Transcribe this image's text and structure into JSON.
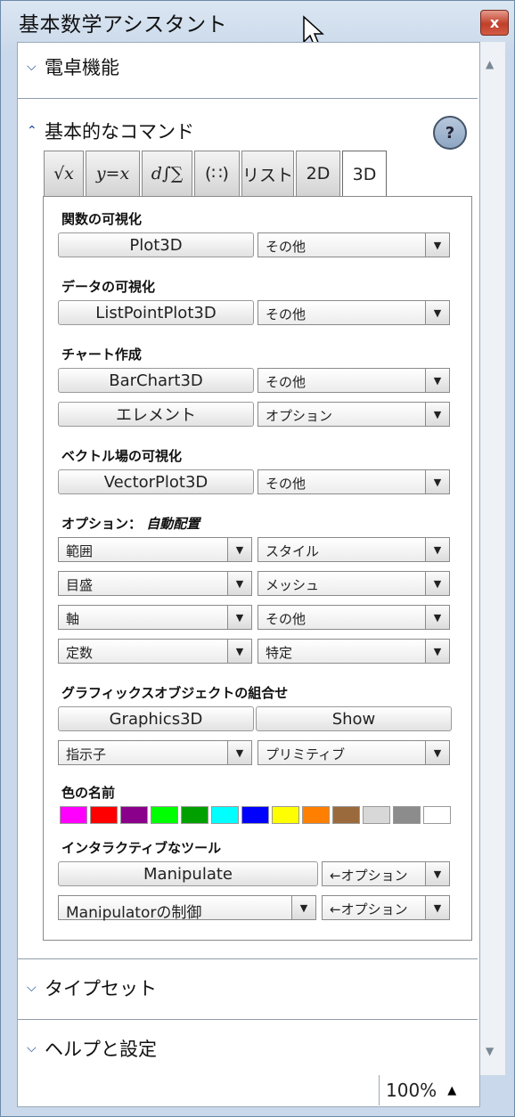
{
  "window": {
    "title": "基本数学アシスタント",
    "close_label": "x"
  },
  "sections": {
    "calculator": "電卓機能",
    "basic_commands": "基本的なコマンド",
    "typeset": "タイプセット",
    "help_settings": "ヘルプと設定"
  },
  "help_button": "?",
  "tabs": [
    "√x",
    "y=x",
    "d∫∑",
    "(∷)",
    "リスト",
    "2D",
    "3D"
  ],
  "groups": {
    "function_viz": "関数の可視化",
    "data_viz": "データの可視化",
    "chart": "チャート作成",
    "vector_viz": "ベクトル場の可視化",
    "options_prefix": "オプション：",
    "options_auto": "自動配置",
    "graphics_combo": "グラフィックスオブジェクトの組合せ",
    "color_names": "色の名前",
    "interactive": "インタラクティブなツール"
  },
  "buttons": {
    "plot3d": "Plot3D",
    "listpointplot3d": "ListPointPlot3D",
    "barchart3d": "BarChart3D",
    "element": "エレメント",
    "vectorplot3d": "VectorPlot3D",
    "graphics3d": "Graphics3D",
    "show": "Show",
    "manipulate": "Manipulate"
  },
  "dropdowns": {
    "other": "その他",
    "option": "オプション",
    "range": "範囲",
    "style": "スタイル",
    "ticks": "目盛",
    "mesh": "メッシュ",
    "axes": "軸",
    "constant": "定数",
    "specific": "特定",
    "directive": "指示子",
    "primitive": "プリミティブ",
    "manipulator_control": "Manipulatorの制御",
    "arrow_option": "←オプション"
  },
  "colors": [
    "#ff00ff",
    "#ff0000",
    "#8b008b",
    "#00ff00",
    "#00a000",
    "#00ffff",
    "#0000ff",
    "#ffff00",
    "#ff8000",
    "#9b6a3c",
    "#d8d8d8",
    "#8c8c8c",
    "#ffffff"
  ],
  "status": {
    "zoom": "100%"
  }
}
